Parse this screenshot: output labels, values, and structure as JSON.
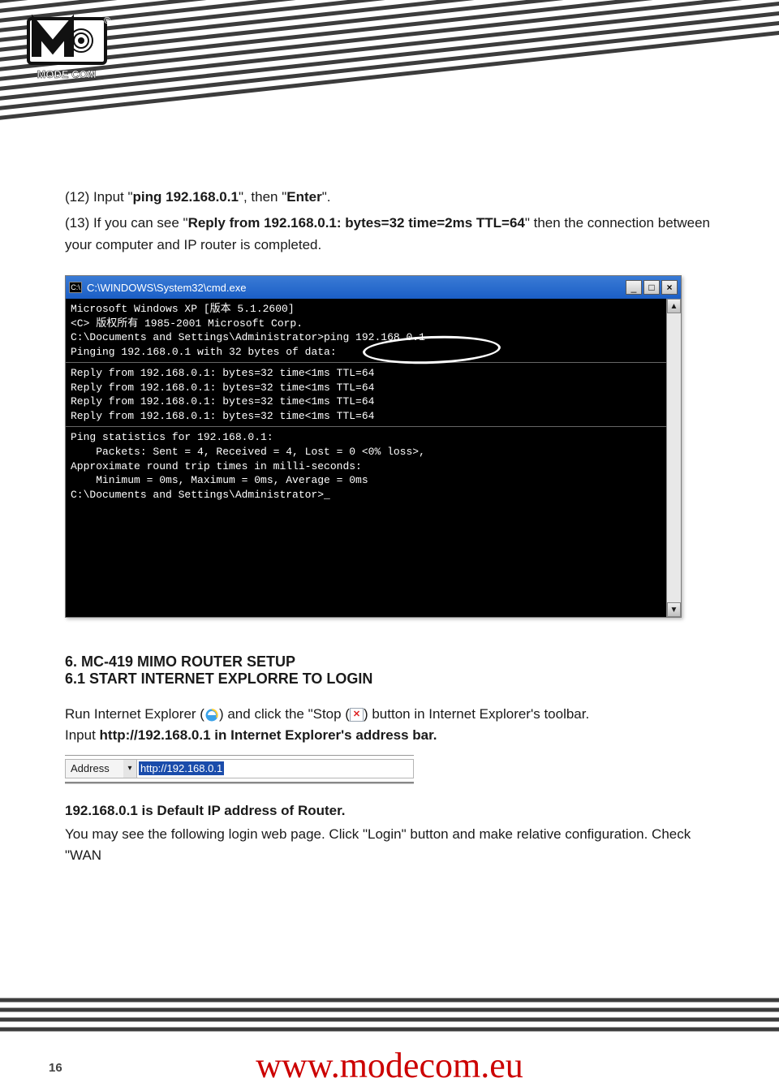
{
  "logo": {
    "brand": "MODE COM",
    "reg": "®"
  },
  "intro": {
    "line12_a": "(12) Input \"",
    "line12_b": "ping 192.168.0.1",
    "line12_c": "\", then \"",
    "line12_d": "Enter",
    "line12_e": "\".",
    "line13_a": "(13) If you can see \"",
    "line13_b": "Reply from 192.168.0.1: bytes=32 time=2ms TTL=64",
    "line13_c": "\" then the connection between your computer and IP router is completed."
  },
  "cmd": {
    "title": "C:\\WINDOWS\\System32\\cmd.exe",
    "icon": "C:\\",
    "min": "_",
    "max": "□",
    "close": "×",
    "scroll_up": "▲",
    "scroll_down": "▼",
    "lines": {
      "l0": "Microsoft Windows XP [版本 5.1.2600]",
      "l1": "<C> 版权所有 1985-2001 Microsoft Corp.",
      "l2": "",
      "l3": "C:\\Documents and Settings\\Administrator>ping 192.168.0.1",
      "l4": "",
      "l5": "Pinging 192.168.0.1 with 32 bytes of data:",
      "l6": "",
      "l7": "Reply from 192.168.0.1: bytes=32 time<1ms TTL=64",
      "l8": "Reply from 192.168.0.1: bytes=32 time<1ms TTL=64",
      "l9": "Reply from 192.168.0.1: bytes=32 time<1ms TTL=64",
      "l10": "Reply from 192.168.0.1: bytes=32 time<1ms TTL=64",
      "l11": "",
      "l12": "Ping statistics for 192.168.0.1:",
      "l13": "    Packets: Sent = 4, Received = 4, Lost = 0 <0% loss>,",
      "l14": "Approximate round trip times in milli-seconds:",
      "l15": "    Minimum = 0ms, Maximum = 0ms, Average = 0ms",
      "l16": "",
      "l17": "C:\\Documents and Settings\\Administrator>_"
    }
  },
  "section": {
    "head": "6. MC-419 MIMO ROUTER SETUP",
    "sub": "6.1  START INTERNET EXPLORRE TO LOGIN"
  },
  "run": {
    "a": "Run Internet Explorer (",
    "b": ")  and click the \"Stop (",
    "c": ") button in Internet Explorer's toolbar.",
    "d_a": "Input ",
    "d_b": "http://192.168.0.1 in Internet Explorer's address bar."
  },
  "address": {
    "label": "Address",
    "drop": "▾",
    "value": "http://192.168.0.1"
  },
  "default_ip": {
    "a": "192.168.0.1 is Default IP address of Router."
  },
  "followup": "You may see the following login web page. Click \"Login\" button and make relative configuration. Check  \"WAN",
  "footer": {
    "url": "www.modecom.eu",
    "page": "16"
  }
}
